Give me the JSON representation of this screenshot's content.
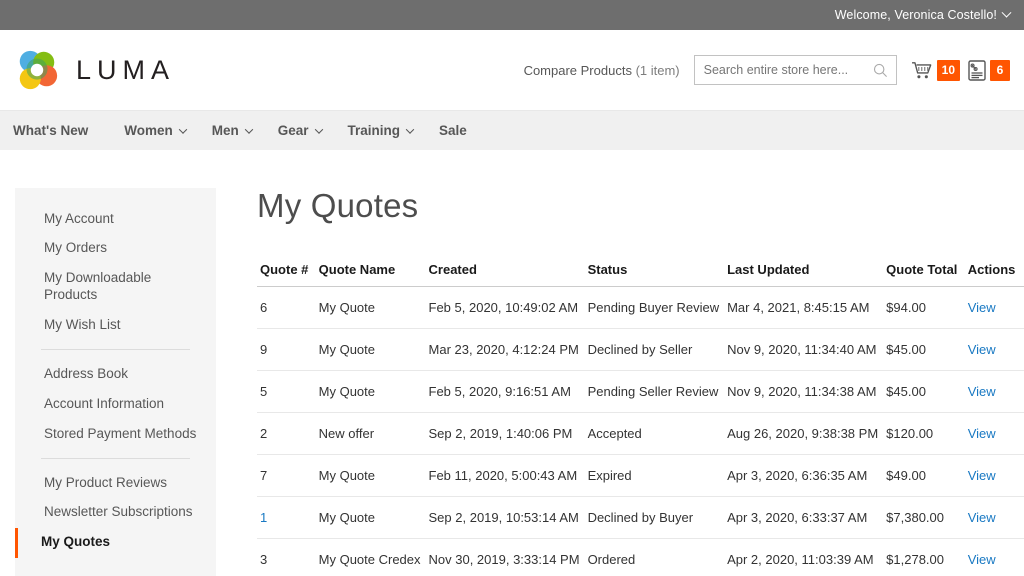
{
  "topbar": {
    "welcome": "Welcome, Veronica Costello!",
    "chevron_icon": "chevron-down-icon"
  },
  "header": {
    "logo_text": "LUMA",
    "logo_icon": "luma-flower-logo",
    "compare_label": "Compare Products",
    "compare_count": "(1 item)",
    "search": {
      "placeholder": "Search entire store here...",
      "value": "",
      "icon": "search-icon"
    },
    "cart": {
      "icon": "shopping-cart-icon",
      "count": "10"
    },
    "quote": {
      "icon": "quote-percent-icon",
      "count": "6"
    }
  },
  "nav": {
    "items": [
      {
        "label": "What's New",
        "has_chevron": false
      },
      {
        "label": "Women",
        "has_chevron": true
      },
      {
        "label": "Men",
        "has_chevron": true
      },
      {
        "label": "Gear",
        "has_chevron": true
      },
      {
        "label": "Training",
        "has_chevron": true
      },
      {
        "label": "Sale",
        "has_chevron": false
      }
    ]
  },
  "sidebar": {
    "groups": [
      {
        "items": [
          {
            "label": "My Account",
            "active": false
          },
          {
            "label": "My Orders",
            "active": false
          },
          {
            "label": "My Downloadable Products",
            "active": false
          },
          {
            "label": "My Wish List",
            "active": false
          }
        ]
      },
      {
        "items": [
          {
            "label": "Address Book",
            "active": false
          },
          {
            "label": "Account Information",
            "active": false
          },
          {
            "label": "Stored Payment Methods",
            "active": false
          }
        ]
      },
      {
        "items": [
          {
            "label": "My Product Reviews",
            "active": false
          },
          {
            "label": "Newsletter Subscriptions",
            "active": false
          },
          {
            "label": "My Quotes",
            "active": true
          }
        ]
      }
    ]
  },
  "main": {
    "title": "My Quotes",
    "table": {
      "columns": [
        "Quote #",
        "Quote Name",
        "Created",
        "Status",
        "Last Updated",
        "Quote Total",
        "Actions"
      ],
      "rows": [
        {
          "quote_no": "6",
          "name": "My Quote",
          "created": "Feb 5, 2020, 10:49:02 AM",
          "status": "Pending Buyer Review",
          "updated": "Mar 4, 2021, 8:45:15 AM",
          "total": "$94.00",
          "action": "View",
          "num_is_link": false
        },
        {
          "quote_no": "9",
          "name": "My Quote",
          "created": "Mar 23, 2020, 4:12:24 PM",
          "status": "Declined by Seller",
          "updated": "Nov 9, 2020, 11:34:40 AM",
          "total": "$45.00",
          "action": "View",
          "num_is_link": false
        },
        {
          "quote_no": "5",
          "name": "My Quote",
          "created": "Feb 5, 2020, 9:16:51 AM",
          "status": "Pending Seller Review",
          "updated": "Nov 9, 2020, 11:34:38 AM",
          "total": "$45.00",
          "action": "View",
          "num_is_link": false
        },
        {
          "quote_no": "2",
          "name": "New offer",
          "created": "Sep 2, 2019, 1:40:06 PM",
          "status": "Accepted",
          "updated": "Aug 26, 2020, 9:38:38 PM",
          "total": "$120.00",
          "action": "View",
          "num_is_link": false
        },
        {
          "quote_no": "7",
          "name": "My Quote",
          "created": "Feb 11, 2020, 5:00:43 AM",
          "status": "Expired",
          "updated": "Apr 3, 2020, 6:36:35 AM",
          "total": "$49.00",
          "action": "View",
          "num_is_link": false
        },
        {
          "quote_no": "1",
          "name": "My Quote",
          "created": "Sep 2, 2019, 10:53:14 AM",
          "status": "Declined by Buyer",
          "updated": "Apr 3, 2020, 6:33:37 AM",
          "total": "$7,380.00",
          "action": "View",
          "num_is_link": true
        },
        {
          "quote_no": "3",
          "name": "My Quote Credex",
          "created": "Nov 30, 2019, 3:33:14 PM",
          "status": "Ordered",
          "updated": "Apr 2, 2020, 11:03:39 AM",
          "total": "$1,278.00",
          "action": "View",
          "num_is_link": false
        }
      ]
    }
  },
  "colors": {
    "topbar_bg": "#6e6e6e",
    "nav_bg": "#f0f0f0",
    "sidebar_bg": "#f5f5f5",
    "accent_orange": "#ff5501",
    "link_blue": "#1979c3"
  }
}
